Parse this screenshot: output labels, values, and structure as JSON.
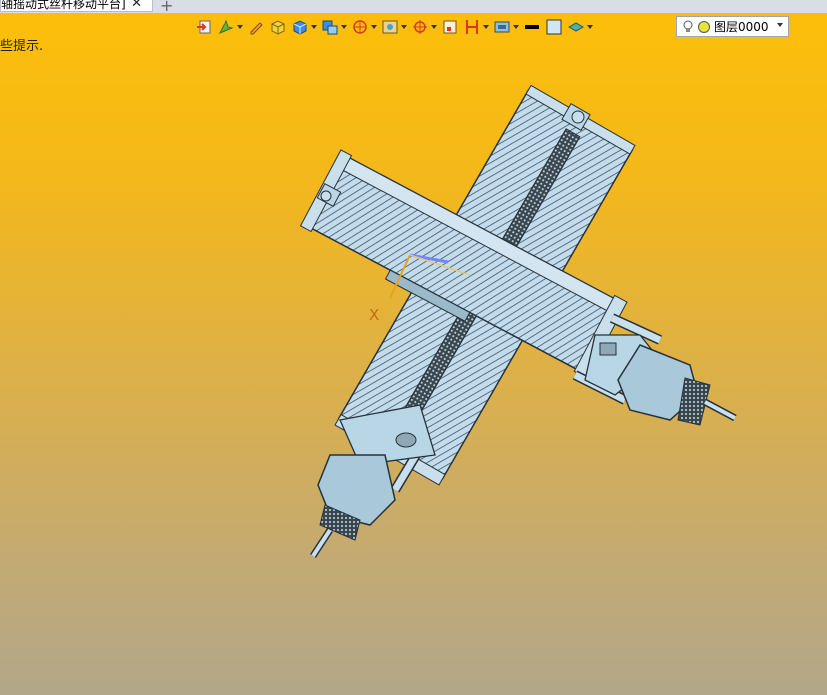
{
  "tab": {
    "title": "轴摇动式丝杆移动平台]",
    "close": "✕",
    "add": "+"
  },
  "status": {
    "hint": "些提示."
  },
  "toolbar": {
    "icons": [
      "import-icon",
      "measure-icon",
      "pencil-icon",
      "solid-box-icon",
      "blue-cube-icon",
      "stack-cube-icon",
      "orbit-icon",
      "view-icon",
      "snap-icon",
      "frame-icon",
      "section-icon",
      "render-icon",
      "line-color-icon",
      "fill-color-icon",
      "layer-style-icon"
    ]
  },
  "layer": {
    "label": "图层0000"
  },
  "triad": {
    "x_label": "X"
  },
  "colors": {
    "accent": "#fdbf08",
    "part": "#b8d6e6",
    "edge": "#2b3a44"
  }
}
